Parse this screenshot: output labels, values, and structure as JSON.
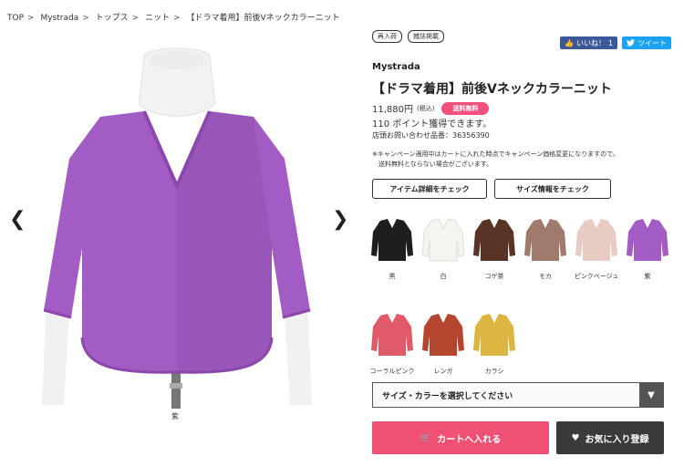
{
  "breadcrumb": [
    "TOP",
    "Mystrada",
    "トップス",
    "ニット",
    "【ドラマ着用】前後Vネックカラーニット"
  ],
  "breadcrumb_sep": ">",
  "photo": {
    "caption": "紫",
    "color": "#a25cc4"
  },
  "tags": [
    "再入荷",
    "雑誌掲載"
  ],
  "social": {
    "like": "いいね！",
    "like_count": "1",
    "tweet": "ツイート"
  },
  "product": {
    "brand": "Mystrada",
    "title": "【ドラマ着用】前後Vネックカラーニット",
    "price": "11,880円",
    "tax": "(税込)",
    "free_shipping": "送料無料",
    "points": "110 ポイント獲得できます。",
    "inquiry": "店頭お問い合わせ品番：36356390",
    "note_line1": "※キャンペーン適用中はカートに入れた時点でキャンペーン価格変更になりますので、",
    "note_line2": "　送料無料とならない場合がございます。"
  },
  "buttons": {
    "detail": "アイテム詳細をチェック",
    "size": "サイズ情報をチェック",
    "cart": "カートへ入れる",
    "favorite": "お気に入り登録"
  },
  "swatches": [
    {
      "label": "黒",
      "color": "#1e1e1e"
    },
    {
      "label": "白",
      "color": "#f6f4ee"
    },
    {
      "label": "コゲ茶",
      "color": "#5a3327"
    },
    {
      "label": "モカ",
      "color": "#a07b6d"
    },
    {
      "label": "ピンクベージュ",
      "color": "#e8ccc4"
    },
    {
      "label": "紫",
      "color": "#a25cc4"
    },
    {
      "label": "コーラルピンク",
      "color": "#e05a6a"
    },
    {
      "label": "レンガ",
      "color": "#b4452f"
    },
    {
      "label": "カラシ",
      "color": "#dcb543"
    }
  ],
  "select": {
    "placeholder": "サイズ・カラーを選択してください"
  },
  "icons": {
    "prev": "chevron-left-icon",
    "next": "chevron-right-icon",
    "cart": "cart-icon",
    "heart": "heart-icon",
    "caret": "caret-down-icon"
  }
}
